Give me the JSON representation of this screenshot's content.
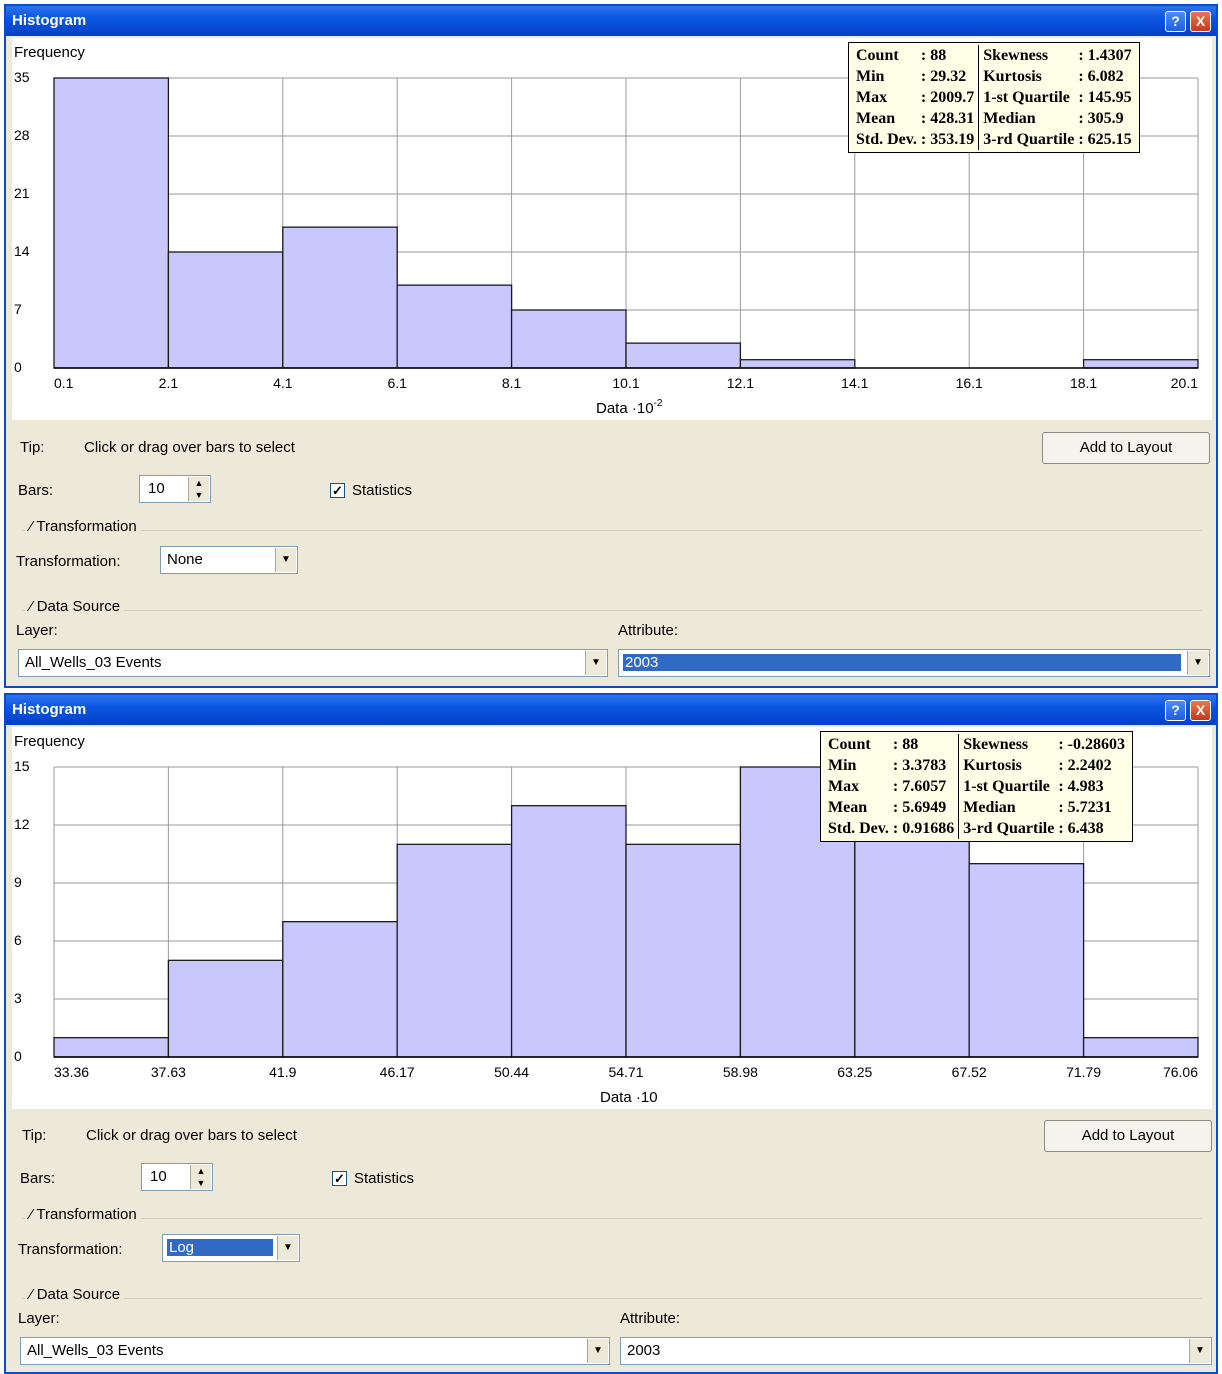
{
  "windows": [
    {
      "title": "Histogram",
      "help_icon": "?",
      "close_icon": "X",
      "chart_data": {
        "type": "bar",
        "ylabel": "Frequency",
        "xlabel": "Data ·10",
        "xlabel_exp": "-2",
        "x_ticks": [
          "0.1",
          "2.1",
          "4.1",
          "6.1",
          "8.1",
          "10.1",
          "12.1",
          "14.1",
          "16.1",
          "18.1",
          "20.1"
        ],
        "y_ticks": [
          "0",
          "7",
          "14",
          "21",
          "28",
          "35"
        ],
        "ylim": [
          0,
          35
        ],
        "values": [
          35,
          14,
          17,
          10,
          7,
          3,
          1,
          0,
          0,
          1
        ],
        "grid": true
      },
      "stats": {
        "left_names": [
          "Count",
          "Min",
          "Max",
          "Mean",
          "Std. Dev."
        ],
        "left_values": [
          ": 88",
          ": 29.32",
          ": 2009.7",
          ": 428.31",
          ": 353.19"
        ],
        "right_names": [
          "Skewness",
          "Kurtosis",
          "1-st Quartile",
          "Median",
          "3-rd Quartile"
        ],
        "right_values": [
          ": 1.4307",
          ": 6.082",
          ": 145.95",
          ": 305.9",
          ": 625.15"
        ]
      },
      "tip_label": "Tip:",
      "tip_text": "Click or drag over bars to select",
      "add_to_layout": "Add to Layout",
      "bars_label": "Bars:",
      "bars_value": "10",
      "statistics_label": "Statistics",
      "statistics_checked": true,
      "transformation_group": "Transformation",
      "transformation_label": "Transformation:",
      "transformation_value": "None",
      "data_source_group": "Data Source",
      "layer_label": "Layer:",
      "layer_value": "All_Wells_03 Events",
      "attribute_label": "Attribute:",
      "attribute_value": "2003"
    },
    {
      "title": "Histogram",
      "help_icon": "?",
      "close_icon": "X",
      "chart_data": {
        "type": "bar",
        "ylabel": "Frequency",
        "xlabel": "Data ·10",
        "xlabel_exp": "",
        "x_ticks": [
          "33.36",
          "37.63",
          "41.9",
          "46.17",
          "50.44",
          "54.71",
          "58.98",
          "63.25",
          "67.52",
          "71.79",
          "76.06"
        ],
        "y_ticks": [
          "0",
          "3",
          "6",
          "9",
          "12",
          "15"
        ],
        "ylim": [
          0,
          15
        ],
        "values": [
          1,
          5,
          7,
          11,
          13,
          11,
          15,
          12,
          10,
          1
        ],
        "grid": true
      },
      "stats": {
        "left_names": [
          "Count",
          "Min",
          "Max",
          "Mean",
          "Std. Dev."
        ],
        "left_values": [
          ": 88",
          ": 3.3783",
          ": 7.6057",
          ": 5.6949",
          ": 0.91686"
        ],
        "right_names": [
          "Skewness",
          "Kurtosis",
          "1-st Quartile",
          "Median",
          "3-rd Quartile"
        ],
        "right_values": [
          ": -0.28603",
          ": 2.2402",
          ": 4.983",
          ": 5.7231",
          ": 6.438"
        ]
      },
      "tip_label": "Tip:",
      "tip_text": "Click or drag over bars to select",
      "add_to_layout": "Add to Layout",
      "bars_label": "Bars:",
      "bars_value": "10",
      "statistics_label": "Statistics",
      "statistics_checked": true,
      "transformation_group": "Transformation",
      "transformation_label": "Transformation:",
      "transformation_value": "Log",
      "data_source_group": "Data Source",
      "layer_label": "Layer:",
      "layer_value": "All_Wells_03 Events",
      "attribute_label": "Attribute:",
      "attribute_value": "2003"
    }
  ]
}
